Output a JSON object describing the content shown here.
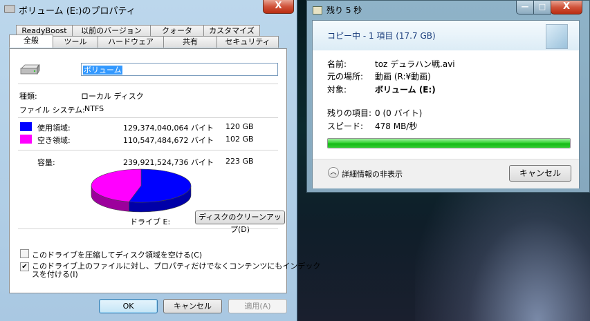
{
  "colors": {
    "used": "#0000ff",
    "free": "#ff00ff",
    "progress": "#22c322"
  },
  "properties_window": {
    "title": "ボリューム (E:)のプロパティ",
    "close_glyph": "X",
    "tabs_row1": [
      "ReadyBoost",
      "以前のバージョン",
      "クォータ",
      "カスタマイズ"
    ],
    "tabs_row2": [
      "全般",
      "ツール",
      "ハードウェア",
      "共有",
      "セキュリティ"
    ],
    "volume_name": "ボリューム",
    "type_label": "種類:",
    "type_value": "ローカル ディスク",
    "fs_label": "ファイル システム:",
    "fs_value": "NTFS",
    "used_label": "使用領域:",
    "used_bytes": "129,374,040,064 バイト",
    "used_gb": "120 GB",
    "free_label": "空き領域:",
    "free_bytes": "110,547,484,672 バイト",
    "free_gb": "102 GB",
    "capacity_label": "容量:",
    "capacity_bytes": "239,921,524,736 バイト",
    "capacity_gb": "223 GB",
    "used_fraction": 0.539,
    "drive_label": "ドライブ E:",
    "cleanup_button": "ディスクのクリーンアップ(D)",
    "compress_label": "このドライブを圧縮してディスク領域を空ける(C)",
    "compress_checked": false,
    "index_label_line1": "このドライブ上のファイルに対し、プロパティだけでなくコンテンツにもインデック",
    "index_label_line2": "スを付ける(I)",
    "index_checked": true,
    "ok_button": "OK",
    "cancel_button": "キャンセル",
    "apply_button": "適用(A)"
  },
  "copy_window": {
    "title": "残り 5 秒",
    "minimize_glyph": "—",
    "maximize_glyph": "□",
    "close_glyph": "X",
    "header": "コピー中 - 1 項目 (17.7 GB)",
    "name_label": "名前:",
    "name_value": "toz デュラハン戦.avi",
    "from_label": "元の場所:",
    "from_value": "動画 (R:¥動画)",
    "to_label": "対象:",
    "to_value": "ボリューム (E:)",
    "remaining_label": "残りの項目:",
    "remaining_value": "0 (0 バイト)",
    "speed_label": "スピード:",
    "speed_value": "478 MB/秒",
    "progress_percent": 100,
    "details_toggle": "詳細情報の非表示",
    "cancel_button": "キャンセル"
  }
}
